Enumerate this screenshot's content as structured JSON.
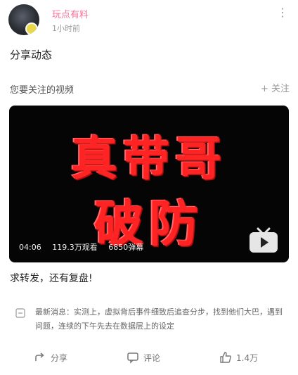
{
  "header": {
    "author": "玩点有料",
    "time": "1小时前",
    "more_icon": "more-vertical-icon"
  },
  "post": {
    "text": "分享动态"
  },
  "follow": {
    "title": "您要关注的视频",
    "button": "+ 关注"
  },
  "video": {
    "cover_line1": "真带哥",
    "cover_line2": "破防",
    "duration": "04:06",
    "views": "119.3万观看",
    "danmaku": "6850弹幕",
    "title": "求转发，还有复盘!",
    "brand_color": "#fb7299"
  },
  "description": {
    "text": "最新消息：实测上，虚拟背后事件细致后追查分步，找到他们大巴，遇到问题，连续的下午先去在数据层上的设定"
  },
  "actions": [
    {
      "icon": "share-icon",
      "label": "分享"
    },
    {
      "icon": "comment-icon",
      "label": "评论"
    },
    {
      "icon": "like-icon",
      "label": "1.4万"
    }
  ]
}
